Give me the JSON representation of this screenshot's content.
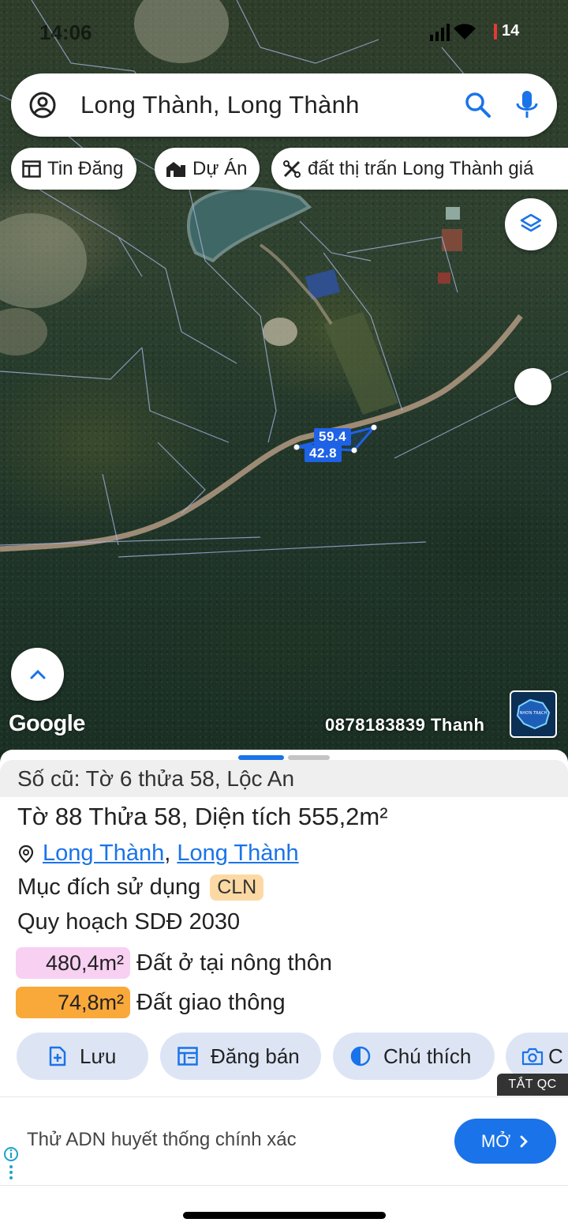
{
  "status": {
    "time": "14:06",
    "battery": "14"
  },
  "search": {
    "query": "Long Thành, Long Thành"
  },
  "chips": [
    {
      "label": "Tin Đăng",
      "icon": "listing-icon"
    },
    {
      "label": "Dự Án",
      "icon": "project-icon"
    },
    {
      "label": "đất thị trấn Long Thành giá",
      "icon": "tools-icon"
    }
  ],
  "map": {
    "measure_top": "59.4",
    "measure_bottom": "42.8",
    "google": "Google",
    "watermark": "0878183839 Thanh",
    "logo_text": "NHƠN TRẠCH"
  },
  "sheet": {
    "old": "Số cũ: Tờ 6 thửa 58, Lộc An",
    "title": "Tờ 88 Thửa 58, Diện tích 555,2m²",
    "addr_1": "Long Thành",
    "addr_sep": ",",
    "addr_2": "Long Thành",
    "purpose_label": "Mục đích sử dụng",
    "purpose_code": "CLN",
    "plan": "Quy hoạch SDĐ 2030",
    "areas": [
      {
        "value": "480,4m²",
        "label": "Đất ở tại nông thôn",
        "color": "#f7d0f2"
      },
      {
        "value": "74,8m²",
        "label": "Đất giao thông",
        "color": "#f9a83a"
      }
    ],
    "actions": [
      {
        "label": "Lưu"
      },
      {
        "label": "Đăng bán"
      },
      {
        "label": "Chú thích"
      },
      {
        "label": "C"
      }
    ]
  },
  "ad": {
    "hide_label": "TẮT QC",
    "text": "Thử ADN huyết thống chính xác",
    "open_label": "MỞ"
  },
  "colors": {
    "accent": "#1a73e8",
    "chip_bg": "#dde5f5",
    "measure": "#1e62e6"
  }
}
